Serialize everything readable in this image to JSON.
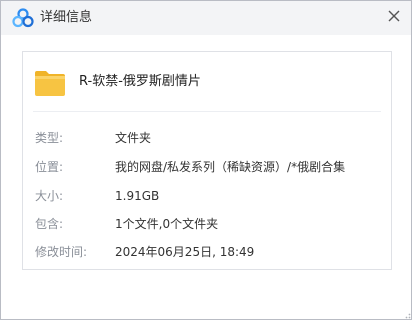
{
  "window": {
    "title": "详细信息",
    "logo_icon": "baidu-netdisk-logo",
    "close_icon": "close-icon"
  },
  "file": {
    "icon": "folder-icon",
    "name": "R-软禁-俄罗斯剧情片"
  },
  "details": [
    {
      "label": "类型:",
      "value": "文件夹"
    },
    {
      "label": "位置:",
      "value": "我的网盘/私发系列（稀缺资源）/*俄剧合集"
    },
    {
      "label": "大小:",
      "value": "1.91GB"
    },
    {
      "label": "包含:",
      "value": "1个文件,0个文件夹"
    },
    {
      "label": "修改时间:",
      "value": "2024年06月25日, 18:49"
    }
  ],
  "colors": {
    "titlebar_bg": "#f3f4f6",
    "folder_yellow": "#f7c442",
    "label_gray": "#8a8f98"
  }
}
